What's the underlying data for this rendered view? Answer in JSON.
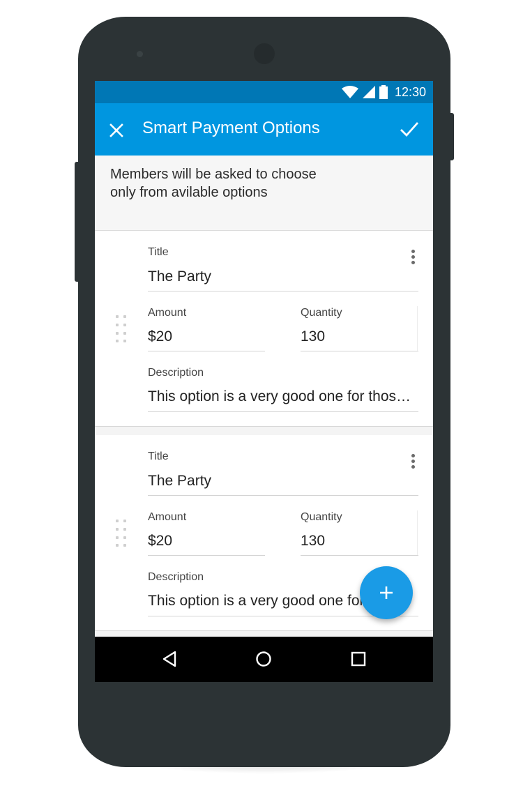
{
  "status_bar": {
    "time": "12:30",
    "icons": [
      "wifi-icon",
      "signal-icon",
      "battery-icon"
    ]
  },
  "app_bar": {
    "title": "Smart Payment Options",
    "close_icon": "close-icon",
    "confirm_icon": "check-icon"
  },
  "info": {
    "line1": "Members will be asked to choose",
    "line2": "only from avilable options"
  },
  "options": [
    {
      "title_label": "Title",
      "title_value": "The Party",
      "amount_label": "Amount",
      "amount_value": "$20",
      "quantity_label": "Quantity",
      "quantity_value": "130",
      "description_label": "Description",
      "description_value": "This option is a very good one for those who want to party"
    },
    {
      "title_label": "Title",
      "title_value": "The Party",
      "amount_label": "Amount",
      "amount_value": "$20",
      "quantity_label": "Quantity",
      "quantity_value": "130",
      "description_label": "Description",
      "description_value": "This option is a very good one for those who want to party"
    }
  ],
  "fab": {
    "icon": "plus-icon"
  },
  "nav_bar": {
    "back_icon": "back-triangle-icon",
    "home_icon": "home-circle-icon",
    "recents_icon": "recents-square-icon"
  },
  "colors": {
    "status_bar": "#0077b5",
    "app_bar": "#0096e0",
    "fab": "#1a9be6",
    "device": "#2c3335"
  }
}
